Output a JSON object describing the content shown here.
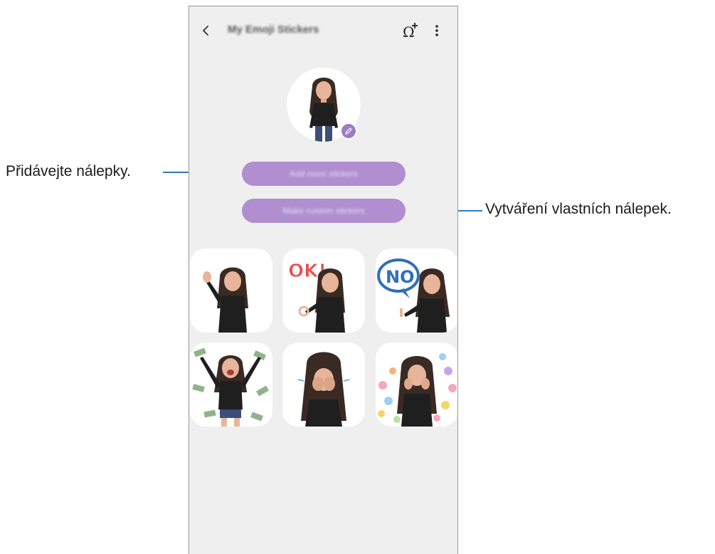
{
  "appbar": {
    "title": "My Emoji Stickers",
    "back_icon": "chevron-left-icon",
    "add_icon": "omega-plus-icon",
    "more_icon": "more-vert-icon"
  },
  "profile": {
    "edit_icon": "pencil-icon"
  },
  "actions": {
    "add_stickers": "Add more stickers",
    "make_custom": "Make custom stickers"
  },
  "stickers": [
    {
      "name": "sticker-wave"
    },
    {
      "name": "sticker-ok",
      "text": "OK!"
    },
    {
      "name": "sticker-no",
      "text": "NO"
    },
    {
      "name": "sticker-money"
    },
    {
      "name": "sticker-facepalm"
    },
    {
      "name": "sticker-hearts"
    }
  ],
  "callouts": {
    "left": "Přidávejte nálepky.",
    "right": "Vytváření vlastních nálepek."
  },
  "colors": {
    "accent": "#b08ed0",
    "badge": "#9d7cc7",
    "leader": "#2e7bbf",
    "screen_bg": "#efefef"
  }
}
